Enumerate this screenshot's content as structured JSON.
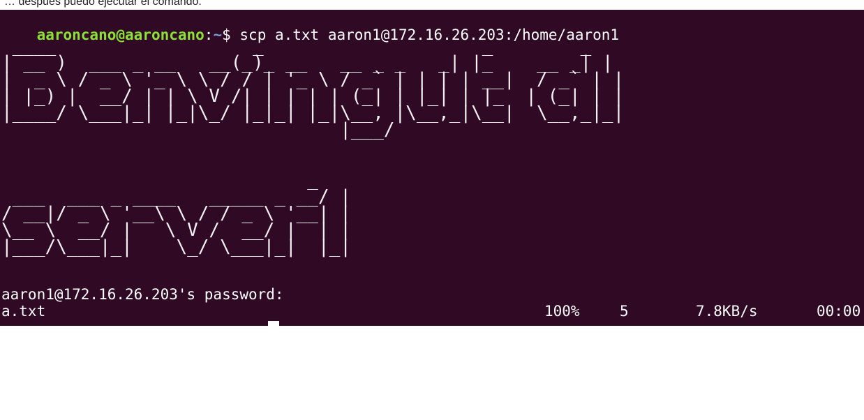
{
  "caption": "… despues puedo ejecutar el comando.",
  "prompt": {
    "user_host": "aaroncano@aaroncano",
    "sep": ":",
    "path": "~",
    "symbol": "$ ",
    "command": "scp a.txt aaron1@172.16.26.203:/home/aaron1"
  },
  "banner_line1": " ____                  _                    _        _ \n| __ )  ___ _ __   __(_)_ __   __ _ _   _| |_    __ _| |\n|  _ \\ / _ \\ '_ \\ \\ / / | '_ \\ / _` | | | | __|  / _` | |\n| |_) |  __/ | | \\ V /| | | | | (_| | |_| | |_  | (_| | |\n|____/ \\___|_| |_|\\_/ |_|_| |_|\\__, |\\__,_|\\__|  \\__,_|_|\n                               |___/                      ",
  "banner_line2": "                            _ \n ___  ___ _ ____   _____ _ __/ |\n/ __|/ _ \\ '__\\ \\ / / _ \\ '__| |\n\\__ \\  __/ |   \\ V /  __/ |  | |\n|___/\\___|_|    \\_/ \\___|_|  |_|",
  "password_prompt": "aaron1@172.16.26.203's password:",
  "transfer": {
    "file": "a.txt",
    "percent": "100%",
    "size": "5",
    "rate": "7.8KB/s",
    "time": "00:00"
  },
  "colors": {
    "background": "#300a24",
    "user_host": "#8ae234",
    "path": "#729fcf",
    "text": "#ffffff"
  }
}
